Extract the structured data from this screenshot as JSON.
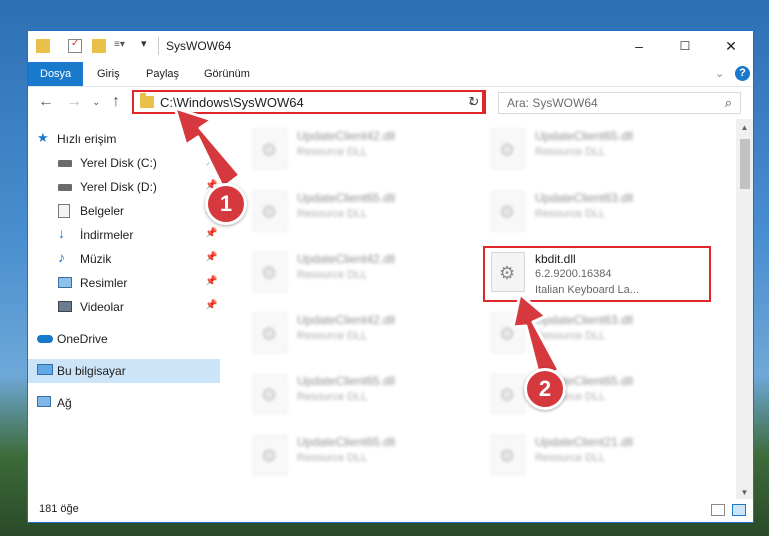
{
  "window": {
    "title": "SysWOW64",
    "controls": {
      "minimize": "–",
      "maximize": "☐",
      "close": "✕"
    }
  },
  "ribbon": {
    "tabs": [
      {
        "label": "Dosya"
      },
      {
        "label": "Giriş"
      },
      {
        "label": "Paylaş"
      },
      {
        "label": "Görünüm"
      }
    ]
  },
  "nav": {
    "address": "C:\\Windows\\SysWOW64",
    "search_placeholder": "Ara: SysWOW64"
  },
  "sidebar": {
    "items": [
      {
        "label": "Hızlı erişim",
        "icon": "star-icon"
      },
      {
        "label": "Yerel Disk (C:)",
        "icon": "drive-icon"
      },
      {
        "label": "Yerel Disk (D:)",
        "icon": "drive-icon"
      },
      {
        "label": "Belgeler",
        "icon": "documents-icon"
      },
      {
        "label": "İndirmeler",
        "icon": "download-icon"
      },
      {
        "label": "Müzik",
        "icon": "music-icon"
      },
      {
        "label": "Resimler",
        "icon": "pictures-icon"
      },
      {
        "label": "Videolar",
        "icon": "videos-icon"
      },
      {
        "label": "OneDrive",
        "icon": "cloud-icon"
      },
      {
        "label": "Bu bilgisayar",
        "icon": "computer-icon"
      },
      {
        "label": "Ağ",
        "icon": "network-icon"
      }
    ]
  },
  "files": {
    "col1": [
      {
        "name": "UpdateClient42.dll",
        "type": "Resource DLL"
      },
      {
        "name": "UpdateClient65.dll",
        "type": "Resource DLL"
      },
      {
        "name": "UpdateClient42.dll",
        "type": "Resource DLL"
      },
      {
        "name": "UpdateClient42.dll",
        "type": "Resource DLL"
      },
      {
        "name": "UpdateClient65.dll",
        "type": "Resource DLL"
      },
      {
        "name": "UpdateClient65.dll",
        "type": "Resource DLL"
      }
    ],
    "col2": [
      {
        "name": "UpdateClient65.dll",
        "type": "Resource DLL"
      },
      {
        "name": "UpdateClient63.dll",
        "type": "Resource DLL"
      },
      {
        "name": "UpdateClient63.dll",
        "type": "Resource DLL"
      },
      {
        "name": "UpdateClient65.dll",
        "type": "Resource DLL"
      },
      {
        "name": "UpdateClient21.dll",
        "type": "Resource DLL"
      }
    ],
    "highlighted": {
      "name": "kbdit.dll",
      "version": "6.2.9200.16384",
      "description": "Italian Keyboard La..."
    }
  },
  "status": {
    "count": "181 öğe"
  },
  "annotations": {
    "step1": "1",
    "step2": "2"
  },
  "colors": {
    "accent": "#1979ca",
    "highlight": "#e0262b",
    "badge": "#d5383d"
  }
}
